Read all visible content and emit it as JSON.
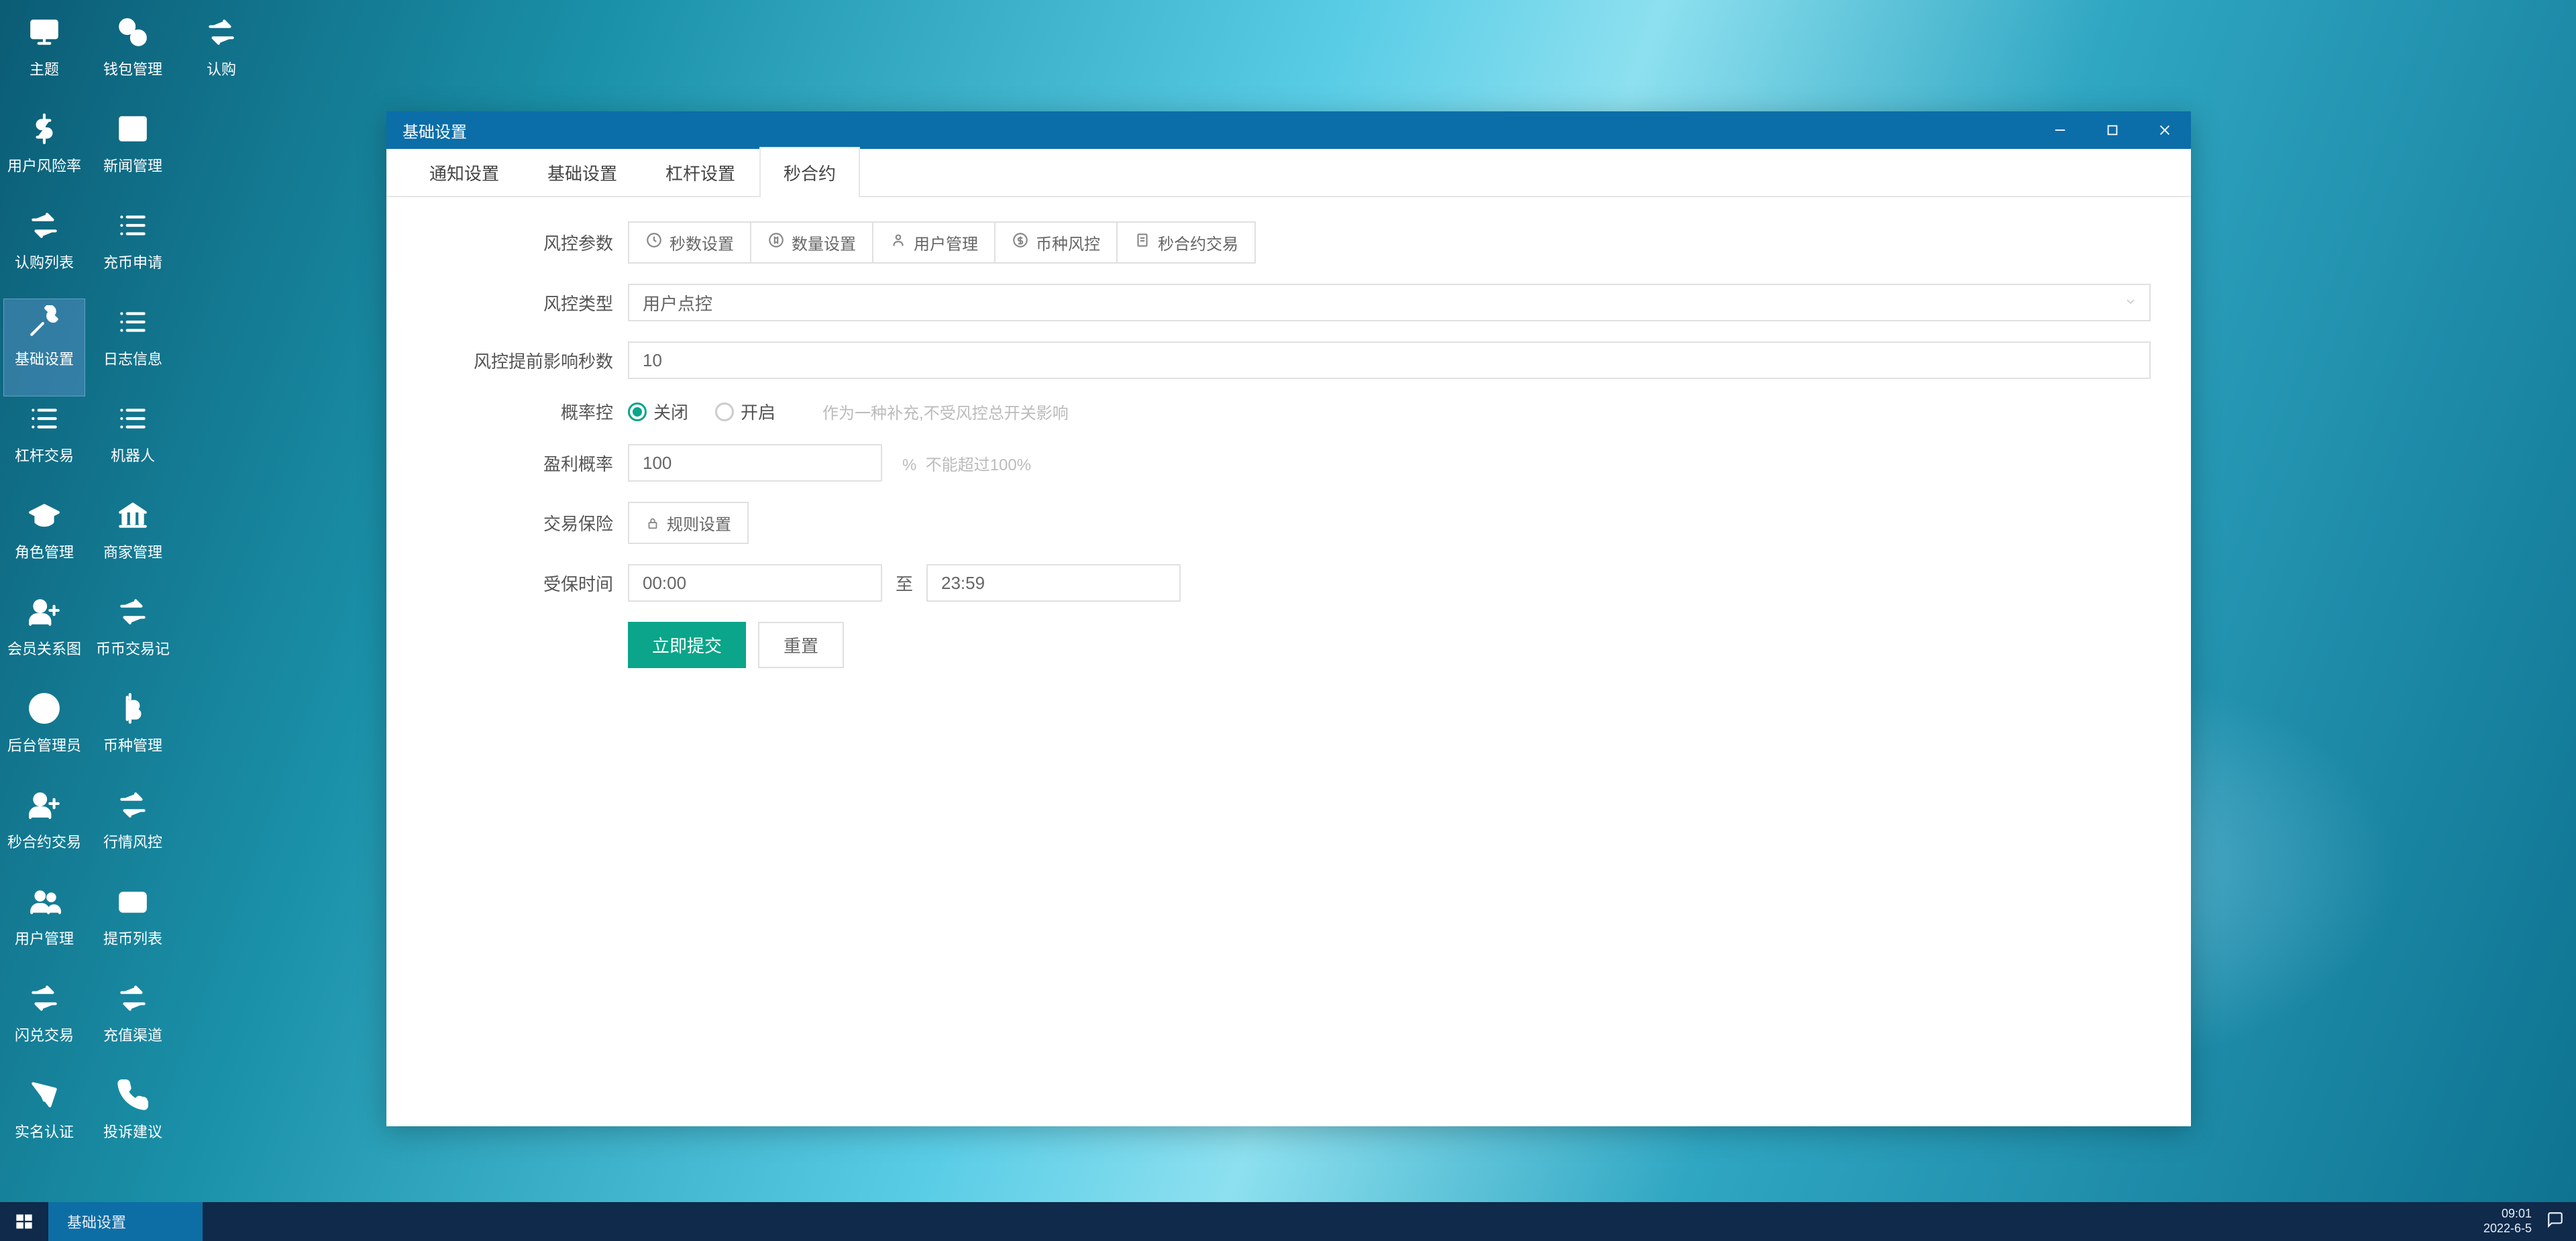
{
  "desktop": {
    "icons": [
      {
        "label": "主题",
        "icon": "monitor"
      },
      {
        "label": "用户风险率",
        "icon": "dollar"
      },
      {
        "label": "认购列表",
        "icon": "swap"
      },
      {
        "label": "基础设置",
        "icon": "wrench",
        "selected": true
      },
      {
        "label": "杠杆交易",
        "icon": "list"
      },
      {
        "label": "角色管理",
        "icon": "grad-cap"
      },
      {
        "label": "会员关系图",
        "icon": "user-plus"
      },
      {
        "label": "后台管理员",
        "icon": "user-circle"
      },
      {
        "label": "秒合约交易",
        "icon": "user-plus"
      },
      {
        "label": "用户管理",
        "icon": "users"
      },
      {
        "label": "闪兑交易",
        "icon": "swap"
      },
      {
        "label": "实名认证",
        "icon": "id-card"
      },
      {
        "label": "钱包管理",
        "icon": "coins"
      },
      {
        "label": "新闻管理",
        "icon": "news"
      },
      {
        "label": "充币申请",
        "icon": "list"
      },
      {
        "label": "日志信息",
        "icon": "list"
      },
      {
        "label": "机器人",
        "icon": "list"
      },
      {
        "label": "商家管理",
        "icon": "bank"
      },
      {
        "label": "币币交易记",
        "icon": "swap"
      },
      {
        "label": "币种管理",
        "icon": "bitcoin"
      },
      {
        "label": "行情风控",
        "icon": "swap"
      },
      {
        "label": "提币列表",
        "icon": "card"
      },
      {
        "label": "充值渠道",
        "icon": "swap"
      },
      {
        "label": "投诉建议",
        "icon": "phone"
      },
      {
        "label": "认购",
        "icon": "swap"
      }
    ]
  },
  "window": {
    "title": "基础设置",
    "tabs": [
      "通知设置",
      "基础设置",
      "杠杆设置",
      "秒合约"
    ],
    "active_tab_index": 3,
    "form": {
      "risk_param_label": "风控参数",
      "sub_tabs": [
        "秒数设置",
        "数量设置",
        "用户管理",
        "币种风控",
        "秒合约交易"
      ],
      "risk_type_label": "风控类型",
      "risk_type_value": "用户点控",
      "affect_seconds_label": "风控提前影响秒数",
      "affect_seconds_value": "10",
      "prob_label": "概率控",
      "prob_close": "关闭",
      "prob_open": "开启",
      "prob_help": "作为一种补充,不受风控总开关影响",
      "profit_rate_label": "盈利概率",
      "profit_rate_value": "100",
      "profit_rate_unit": "%",
      "profit_rate_hint": "不能超过100%",
      "insurance_label": "交易保险",
      "insurance_btn": "规则设置",
      "insured_time_label": "受保时间",
      "time_from": "00:00",
      "time_to_sep": "至",
      "time_to": "23:59",
      "submit": "立即提交",
      "reset": "重置"
    }
  },
  "taskbar": {
    "active_task": "基础设置",
    "time": "09:01",
    "date": "2022-6-5"
  }
}
